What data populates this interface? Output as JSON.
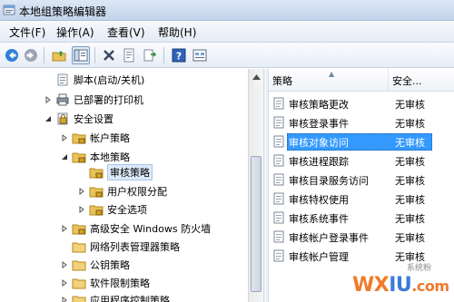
{
  "window": {
    "title": "本地组策略编辑器"
  },
  "menu": [
    {
      "label": "文件(F)"
    },
    {
      "label": "操作(A)"
    },
    {
      "label": "查看(V)"
    },
    {
      "label": "帮助(H)"
    }
  ],
  "toolbar": {
    "buttons": [
      "back-icon",
      "forward-icon",
      "up-folder-icon",
      "show-hide-tree-icon",
      "delete-icon",
      "properties-icon",
      "export-list-icon",
      "help-icon",
      "view-icon"
    ]
  },
  "tree": [
    {
      "label": "脚本(启动/关机)",
      "icon": "script-icon",
      "level": 2,
      "arrow": ""
    },
    {
      "label": "已部署的打印机",
      "icon": "printer-icon",
      "level": 1,
      "arrow": "right"
    },
    {
      "label": "安全设置",
      "icon": "security-settings-icon",
      "level": 1,
      "arrow": "down"
    },
    {
      "label": "帐户策略",
      "icon": "folder-lock-icon",
      "level": 2,
      "arrow": "right"
    },
    {
      "label": "本地策略",
      "icon": "folder-lock-icon",
      "level": 2,
      "arrow": "down"
    },
    {
      "label": "审核策略",
      "icon": "folder-lock-icon",
      "level": 3,
      "arrow": "",
      "selected": true
    },
    {
      "label": "用户权限分配",
      "icon": "folder-lock-icon",
      "level": 3,
      "arrow": "right"
    },
    {
      "label": "安全选项",
      "icon": "folder-lock-icon",
      "level": 3,
      "arrow": "right"
    },
    {
      "label": "高级安全 Windows 防火墙",
      "icon": "folder-lock-icon",
      "level": 2,
      "arrow": "right"
    },
    {
      "label": "网络列表管理器策略",
      "icon": "folder-icon",
      "level": 2,
      "arrow": ""
    },
    {
      "label": "公钥策略",
      "icon": "folder-icon",
      "level": 2,
      "arrow": "right"
    },
    {
      "label": "软件限制策略",
      "icon": "folder-icon",
      "level": 2,
      "arrow": "right"
    },
    {
      "label": "应用程序控制策略",
      "icon": "folder-icon",
      "level": 2,
      "arrow": "right"
    }
  ],
  "list": {
    "columns": {
      "policy": "策略",
      "security": "安全..."
    },
    "rows": [
      {
        "name": "审核策略更改",
        "value": "无审核"
      },
      {
        "name": "审核登录事件",
        "value": "无审核"
      },
      {
        "name": "审核对象访问",
        "value": "无审核",
        "selected": true
      },
      {
        "name": "审核进程跟踪",
        "value": "无审核"
      },
      {
        "name": "审核目录服务访问",
        "value": "无审核"
      },
      {
        "name": "审核特权使用",
        "value": "无审核"
      },
      {
        "name": "审核系统事件",
        "value": "无审核"
      },
      {
        "name": "审核帐户登录事件",
        "value": "无审核"
      },
      {
        "name": "审核帐户管理",
        "value": "无审核"
      }
    ]
  },
  "watermark": {
    "text_a": "WX",
    "text_b": "IU",
    "text_c": ".com",
    "small": "系统粉"
  },
  "colors": {
    "selection": "#3399ff",
    "tree_selection": "#dce9f8",
    "watermark": "#f07a2a"
  }
}
